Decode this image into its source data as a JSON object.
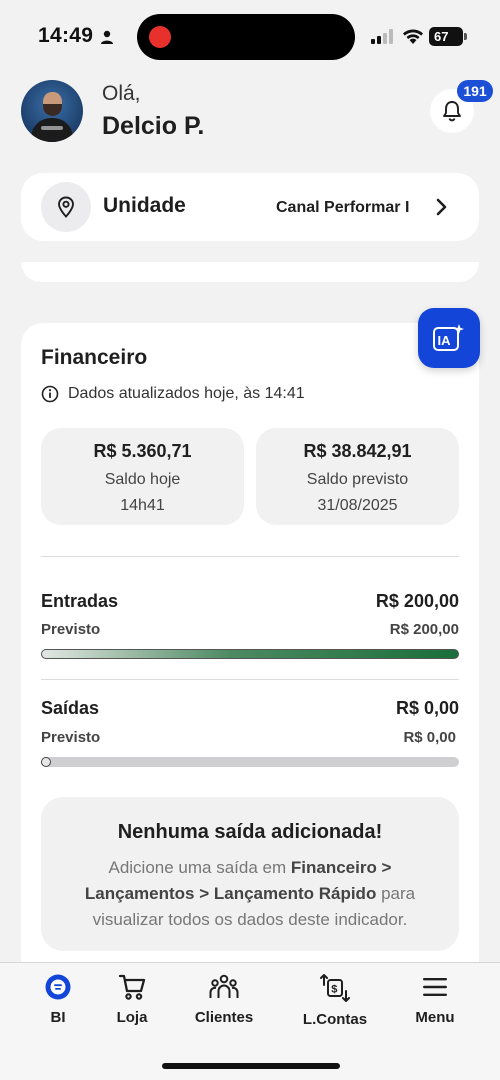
{
  "status_bar": {
    "time": "14:49",
    "battery": "67"
  },
  "header": {
    "greeting": "Olá,",
    "user_name": "Delcio P.",
    "notification_count": "191"
  },
  "unit": {
    "label": "Unidade",
    "value": "Canal Performar I"
  },
  "finance": {
    "title": "Financeiro",
    "updated_text": "Dados atualizados hoje, às 14:41",
    "ia_label": "IA",
    "saldo_hoje": {
      "value": "R$ 5.360,71",
      "label": "Saldo hoje",
      "sub": "14h41"
    },
    "saldo_previsto": {
      "value": "R$ 38.842,91",
      "label": "Saldo previsto",
      "sub": "31/08/2025"
    },
    "entradas": {
      "title": "Entradas",
      "value": "R$ 200,00",
      "sub_label": "Previsto",
      "sub_value": "R$ 200,00",
      "progress": 1.0
    },
    "saidas": {
      "title": "Saídas",
      "value": "R$ 0,00",
      "sub_label": "Previsto",
      "sub_value": "R$ 0,00",
      "progress": 0.0
    },
    "empty_state": {
      "title": "Nenhuma saída adicionada!",
      "text_1": "Adicione uma saída em ",
      "link_1": "Financeiro >",
      "link_2": "Lançamentos > Lançamento Rápido",
      "text_2": " para visualizar todos os dados deste indicador."
    }
  },
  "nav": {
    "items": [
      {
        "label": "BI",
        "icon": "bi-icon",
        "active": true
      },
      {
        "label": "Loja",
        "icon": "cart-icon"
      },
      {
        "label": "Clientes",
        "icon": "people-icon"
      },
      {
        "label": "L.Contas",
        "icon": "transfer-icon"
      },
      {
        "label": "Menu",
        "icon": "menu-icon"
      }
    ]
  },
  "colors": {
    "accent": "#1346d8",
    "progress_green": "#1a6f3a",
    "badge": "#1a4fd6"
  }
}
